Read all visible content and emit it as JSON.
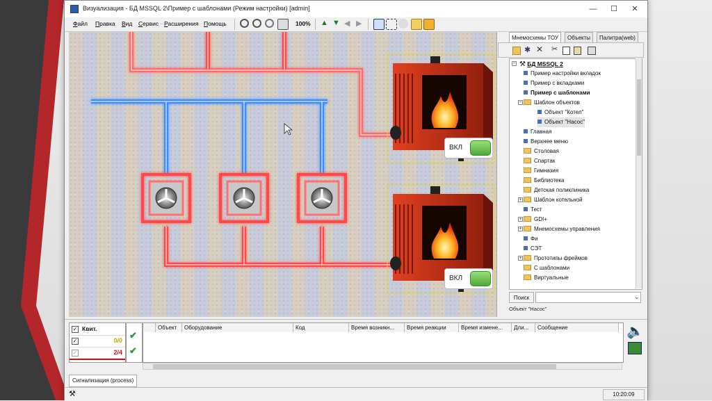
{
  "window": {
    "title": "Визуализация - БД MSSQL 2\\Пример с шаблонами (Режим настройки) [admin]",
    "controls": [
      "—",
      "☐",
      "✕"
    ]
  },
  "menu": [
    "Файл",
    "Правка",
    "Вид",
    "Сервис",
    "Расширения",
    "Помощь"
  ],
  "toolbar": {
    "zoom": "100%"
  },
  "canvas": {
    "boilers": [
      {
        "button_label": "ВКЛ"
      },
      {
        "button_label": "ВКЛ"
      }
    ]
  },
  "right_panel": {
    "tabs": [
      "Мнемосхемы ТОУ",
      "Объекты",
      "Палитра(web)"
    ],
    "tree_root": "БД MSSQL 2",
    "tree": [
      {
        "label": "Пример настройки вкладок",
        "type": "leaf",
        "bold": false
      },
      {
        "label": "Пример с вкладками",
        "type": "leaf",
        "bold": false
      },
      {
        "label": "Пример с шаблонами",
        "type": "leaf",
        "bold": true
      },
      {
        "label": "Шаблон объектов",
        "type": "folder",
        "bold": false
      },
      {
        "label": "Объект \"Котел\"",
        "type": "child",
        "bold": false
      },
      {
        "label": "Объект \"Насос\"",
        "type": "child",
        "bold": false
      },
      {
        "label": "Главная",
        "type": "leaf",
        "bold": false
      },
      {
        "label": "Верхнее меню",
        "type": "leaf",
        "bold": false
      },
      {
        "label": "Столовая",
        "type": "folder",
        "bold": false
      },
      {
        "label": "Спартак",
        "type": "folder",
        "bold": false
      },
      {
        "label": "Гимназия",
        "type": "folder",
        "bold": false
      },
      {
        "label": "Библиотека",
        "type": "folder",
        "bold": false
      },
      {
        "label": "Детская поликлиника",
        "type": "folder",
        "bold": false
      },
      {
        "label": "Шаблон котельной",
        "type": "folder",
        "bold": false
      },
      {
        "label": "Тест",
        "type": "leaf",
        "bold": false
      },
      {
        "label": "GDI+",
        "type": "folder",
        "bold": false
      },
      {
        "label": "Мнемосхемы управления",
        "type": "folder",
        "bold": false
      },
      {
        "label": "Фи",
        "type": "leaf",
        "bold": false
      },
      {
        "label": "СЭТ",
        "type": "leaf",
        "bold": false
      },
      {
        "label": "Прототипы фреймов",
        "type": "folder",
        "bold": false
      },
      {
        "label": "С шаблонами",
        "type": "folder",
        "bold": false
      },
      {
        "label": "Виртуальные",
        "type": "folder",
        "bold": false
      }
    ],
    "search_label": "Поиск",
    "selected_object": "Объект \"Насос\""
  },
  "alarms": {
    "kv_header": "Квит.",
    "kv_rows": [
      {
        "value": "0/0",
        "color": "#c8a400"
      },
      {
        "value": "2/4",
        "color": "#d01010"
      }
    ],
    "columns": [
      "Объект",
      "Оборудование",
      "Код",
      "Время возникн...",
      "Время реакции",
      "Время измене...",
      "Дли...",
      "Сообщение"
    ]
  },
  "bottom_tab": "Сигнализация (process)",
  "status": {
    "time": "10:20:09"
  },
  "colors": {
    "hot_pipe": "#ff3b3b",
    "cold_pipe": "#3b8cff",
    "boiler": "#c8301a",
    "accent_green": "#4fa93a"
  }
}
